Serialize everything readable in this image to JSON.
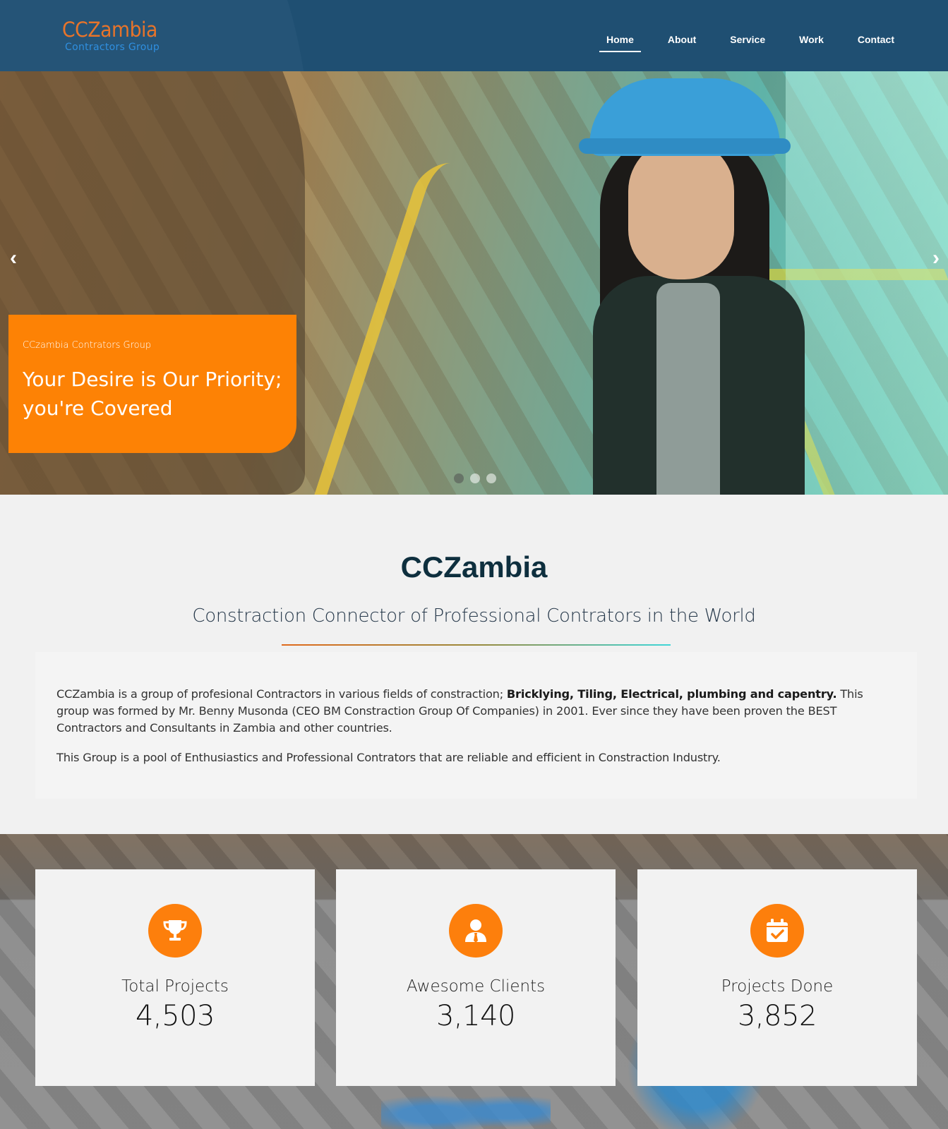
{
  "brand": {
    "name": "CCZambia",
    "tagline": "Contractors Group"
  },
  "nav": {
    "items": [
      {
        "label": "Home",
        "active": true
      },
      {
        "label": "About",
        "active": false
      },
      {
        "label": "Service",
        "active": false
      },
      {
        "label": "Work",
        "active": false
      },
      {
        "label": "Contact",
        "active": false
      }
    ]
  },
  "hero": {
    "caption_small": "CCzambia Contrators Group",
    "caption_big": "Your Desire is Our Priority; you're Covered",
    "prev_icon": "chevron-left-icon",
    "next_icon": "chevron-right-icon",
    "prev_glyph": "‹",
    "next_glyph": "›",
    "slides_total": 3,
    "active_slide": 1,
    "accent_color": "#fd8205"
  },
  "about": {
    "title": "CCZambia",
    "subtitle": "Constraction Connector of Professional Contrators in the World",
    "para1_start": "CCZambia is a group of profesional Contractors in various fields of constraction; ",
    "para1_bold": "Bricklying, Tiling, Electrical, plumbing and capentry.",
    "para1_end": " This group was formed by Mr. Benny Musonda (CEO BM Constraction Group Of Companies) in 2001. Ever since they have been proven the BEST Contractors and Consultants in Zambia and other countries.",
    "para2": "This Group is a pool of Enthusiastics and Professional Contrators that are reliable and efficient in Constraction Industry."
  },
  "stats": [
    {
      "label": "Total Projects",
      "value": "4,503",
      "icon": "trophy-icon"
    },
    {
      "label": "Awesome Clients",
      "value": "3,140",
      "icon": "user-tie-icon"
    },
    {
      "label": "Projects Done",
      "value": "3,852",
      "icon": "calendar-check-icon"
    }
  ],
  "colors": {
    "header_bg": "#1f4f72",
    "logo": "#e8742a",
    "tagline": "#2f8fe0",
    "orange": "#fd7f0c",
    "title": "#0e2f3e"
  }
}
